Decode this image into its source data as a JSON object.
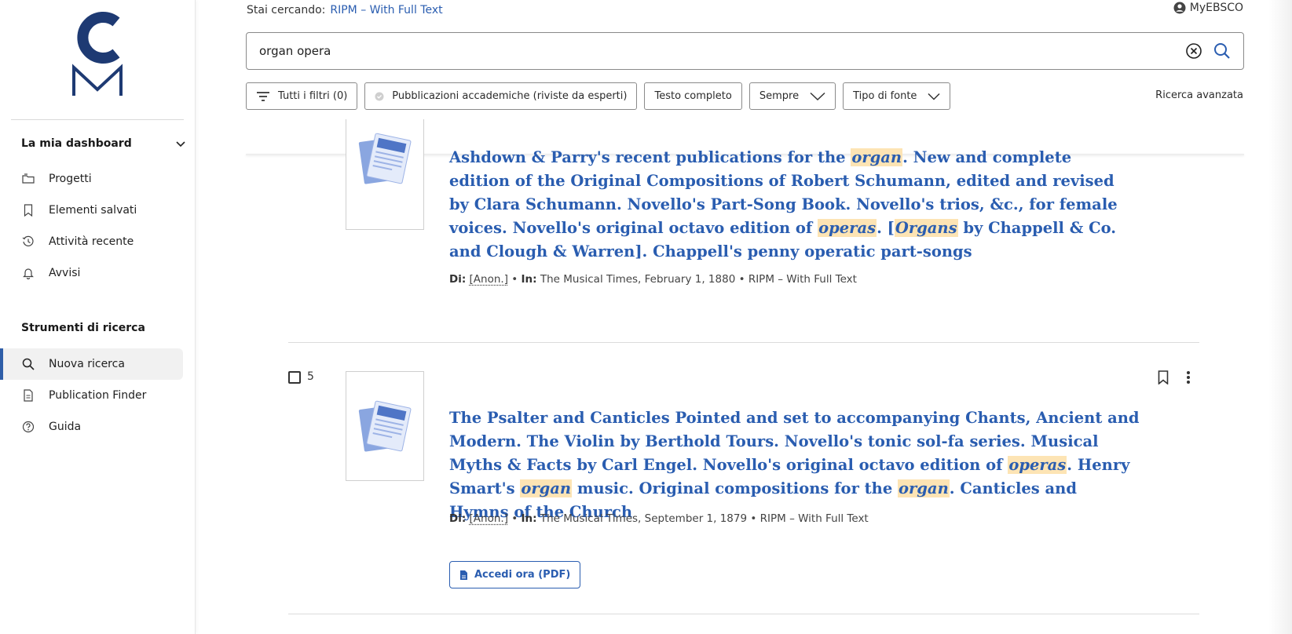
{
  "sidebar": {
    "logo_letters": [
      "C",
      "M"
    ],
    "dashboard_header": "La mia dashboard",
    "dashboard_items": [
      {
        "label": "Progetti",
        "icon": "folder-icon"
      },
      {
        "label": "Elementi salvati",
        "icon": "bookmark-icon"
      },
      {
        "label": "Attività recente",
        "icon": "history-icon"
      },
      {
        "label": "Avvisi",
        "icon": "bell-icon"
      }
    ],
    "tools_header": "Strumenti di ricerca",
    "tools_items": [
      {
        "label": "Nuova ricerca",
        "icon": "search-icon",
        "active": true
      },
      {
        "label": "Publication Finder",
        "icon": "document-icon"
      },
      {
        "label": "Guida",
        "icon": "help-icon"
      }
    ]
  },
  "header": {
    "search_context_label": "Stai cercando:",
    "search_context_db": "RIPM – With Full Text",
    "account_label": "MyEBSCO"
  },
  "search": {
    "query": "organ opera"
  },
  "filters": {
    "all_filters": "Tutti i filtri (0)",
    "peer_reviewed": "Pubblicazioni accademiche (riviste da esperti)",
    "full_text": "Testo completo",
    "date": "Sempre",
    "source_type": "Tipo di fonte",
    "advanced": "Ricerca avanzata"
  },
  "results": [
    {
      "number": "",
      "title_parts": [
        {
          "t": "Ashdown & Parry's recent publications for the "
        },
        {
          "t": "organ",
          "hl": true
        },
        {
          "t": ". New and complete edition of the Original Compositions of Robert Schumann, edited and revised by Clara Schumann. Novello's Part-Song Book. Novello's trios, &c., for female voices. Novello's original octavo edition of "
        },
        {
          "t": "operas",
          "hl": true
        },
        {
          "t": ". ["
        },
        {
          "t": "Organs",
          "hl": true
        },
        {
          "t": " by Chappell & Co. and Clough & Warren]. Chappell's penny operatic part-songs"
        }
      ],
      "by_label": "Di:",
      "author": "[Anon.]",
      "in_label": "In:",
      "source": "The Musical Times, February 1, 1880 • RIPM – With Full Text"
    },
    {
      "number": "5",
      "title_parts": [
        {
          "t": "The Psalter and Canticles Pointed and set to accompanying Chants, Ancient and Modern. The Violin by Berthold Tours. Novello's tonic sol-fa series. Musical Myths & Facts by Carl Engel. Novello's original octavo edition of "
        },
        {
          "t": "operas",
          "hl": true
        },
        {
          "t": ". Henry Smart's "
        },
        {
          "t": "organ",
          "hl": true
        },
        {
          "t": " music. Original compositions for the "
        },
        {
          "t": "organ",
          "hl": true
        },
        {
          "t": ". Canticles and Hymns of the Church"
        }
      ],
      "by_label": "Di:",
      "author": "[Anon.]",
      "in_label": "In:",
      "source": "The Musical Times, September 1, 1879 • RIPM – With Full Text",
      "pdf_label": "Accedi ora (PDF)"
    }
  ],
  "colors": {
    "accent": "#2a5db0",
    "highlight": "#fde4b4",
    "logo": "#1e3a73"
  }
}
